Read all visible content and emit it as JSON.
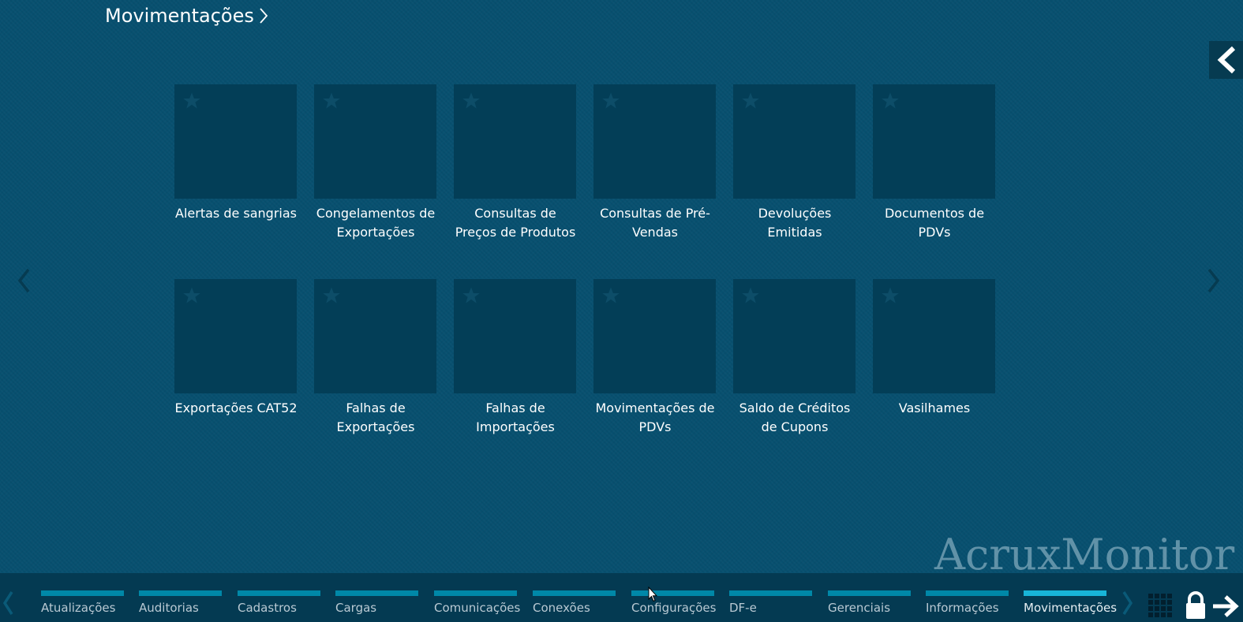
{
  "header": {
    "title": "Movimentações"
  },
  "tiles": [
    {
      "label": "Alertas de sangrias"
    },
    {
      "label": "Congelamentos de Exportações"
    },
    {
      "label": "Consultas de Preços de Produtos"
    },
    {
      "label": "Consultas de Pré-Vendas"
    },
    {
      "label": "Devoluções Emitidas"
    },
    {
      "label": "Documentos de PDVs"
    },
    {
      "label": "Exportações CAT52"
    },
    {
      "label": "Falhas de Exportações"
    },
    {
      "label": "Falhas de Importações"
    },
    {
      "label": "Movimentações de PDVs"
    },
    {
      "label": "Saldo de Créditos de Cupons"
    },
    {
      "label": "Vasilhames"
    }
  ],
  "watermark": "AcruxMonitor",
  "bottom_tabs": [
    {
      "label": "Atualizações",
      "active": false
    },
    {
      "label": "Auditorias",
      "active": false
    },
    {
      "label": "Cadastros",
      "active": false
    },
    {
      "label": "Cargas",
      "active": false
    },
    {
      "label": "Comunicações",
      "active": false
    },
    {
      "label": "Conexões",
      "active": false
    },
    {
      "label": "Configurações",
      "active": false
    },
    {
      "label": "DF-e",
      "active": false
    },
    {
      "label": "Gerenciais",
      "active": false
    },
    {
      "label": "Informações",
      "active": false
    },
    {
      "label": "Movimentações",
      "active": true
    }
  ],
  "icons": {
    "title_chevron": "chevron-right-icon",
    "collapse": "chevron-left-icon",
    "tile_favorite": "star-icon",
    "page_prev": "chevron-left-icon",
    "page_next": "chevron-right-icon",
    "apps": "grid-icon",
    "lock": "lock-icon",
    "exit": "arrow-right-icon"
  },
  "colors": {
    "background": "#07506f",
    "tile": "#033e57",
    "bottom_bar": "#043a52",
    "tab_line": "#0088a8",
    "tab_line_active": "#18b4d8"
  }
}
